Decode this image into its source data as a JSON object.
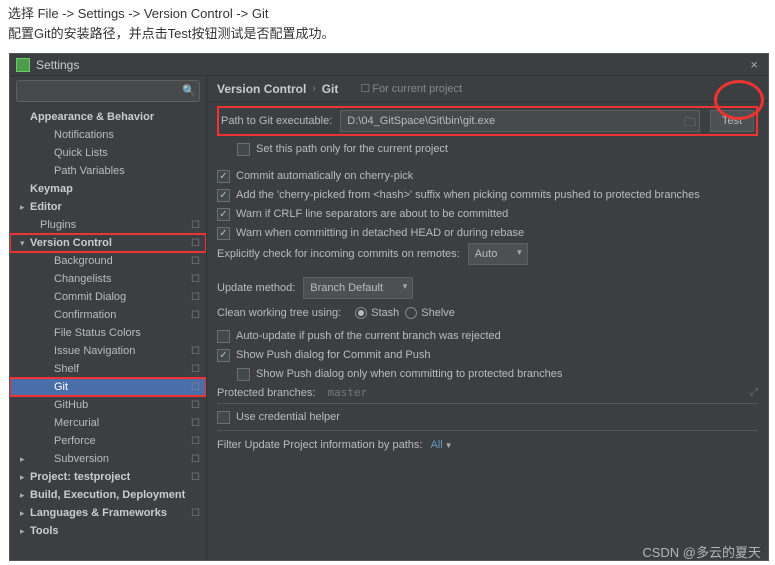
{
  "instructions": {
    "line1": "选择 File -> Settings -> Version Control -> Git",
    "line2": "配置Git的安装路径，并点击Test按钮测试是否配置成功。"
  },
  "window": {
    "title": "Settings",
    "close": "×"
  },
  "search": {
    "placeholder": ""
  },
  "sidebar": {
    "items": [
      {
        "label": "Appearance & Behavior",
        "type": "heading",
        "chevron": ""
      },
      {
        "label": "Notifications",
        "indent": 2
      },
      {
        "label": "Quick Lists",
        "indent": 2
      },
      {
        "label": "Path Variables",
        "indent": 2
      },
      {
        "label": "Keymap",
        "type": "heading"
      },
      {
        "label": "Editor",
        "type": "heading",
        "chevron": "▸"
      },
      {
        "label": "Plugins",
        "indent": 1,
        "gear": true
      },
      {
        "label": "Version Control",
        "type": "heading",
        "chevron": "▾",
        "gear": true,
        "highlight": true
      },
      {
        "label": "Background",
        "indent": 2,
        "gear": true
      },
      {
        "label": "Changelists",
        "indent": 2,
        "gear": true
      },
      {
        "label": "Commit Dialog",
        "indent": 2,
        "gear": true
      },
      {
        "label": "Confirmation",
        "indent": 2,
        "gear": true
      },
      {
        "label": "File Status Colors",
        "indent": 2
      },
      {
        "label": "Issue Navigation",
        "indent": 2,
        "gear": true
      },
      {
        "label": "Shelf",
        "indent": 2,
        "gear": true
      },
      {
        "label": "Git",
        "indent": 2,
        "gear": true,
        "selected": true,
        "highlight": true
      },
      {
        "label": "GitHub",
        "indent": 2,
        "gear": true
      },
      {
        "label": "Mercurial",
        "indent": 2,
        "gear": true
      },
      {
        "label": "Perforce",
        "indent": 2,
        "gear": true
      },
      {
        "label": "Subversion",
        "indent": 2,
        "chevron": "▸",
        "gear": true
      },
      {
        "label": "Project: testproject",
        "type": "heading",
        "chevron": "▸",
        "gear": true
      },
      {
        "label": "Build, Execution, Deployment",
        "type": "heading",
        "chevron": "▸"
      },
      {
        "label": "Languages & Frameworks",
        "type": "heading",
        "chevron": "▸",
        "gear": true
      },
      {
        "label": "Tools",
        "type": "heading",
        "chevron": "▸"
      }
    ]
  },
  "breadcrumb": {
    "c1": "Version Control",
    "sep": "›",
    "c2": "Git",
    "scope": "For current project"
  },
  "main": {
    "path_label": "Path to Git executable:",
    "path_value": "D:\\04_GitSpace\\Git\\bin\\git.exe",
    "test_button": "Test",
    "set_path_only": "Set this path only for the current project",
    "commit_auto": "Commit automatically on cherry-pick",
    "add_cherry": "Add the 'cherry-picked from <hash>' suffix when picking commits pushed to protected branches",
    "warn_crlf": "Warn if CRLF line separators are about to be committed",
    "warn_detached": "Warn when committing in detached HEAD or during rebase",
    "explicit_check": "Explicitly check for incoming commits on remotes:",
    "explicit_value": "Auto",
    "update_method": "Update method:",
    "update_value": "Branch Default",
    "clean_tree": "Clean working tree using:",
    "stash": "Stash",
    "shelve": "Shelve",
    "auto_update": "Auto-update if push of the current branch was rejected",
    "show_push": "Show Push dialog for Commit and Push",
    "show_push_only": "Show Push dialog only when committing to protected branches",
    "protected_label": "Protected branches:",
    "protected_value": "master",
    "cred_helper": "Use credential helper",
    "filter_label": "Filter Update Project information by paths:",
    "filter_value": "All"
  },
  "watermark": "CSDN @多云的夏天"
}
